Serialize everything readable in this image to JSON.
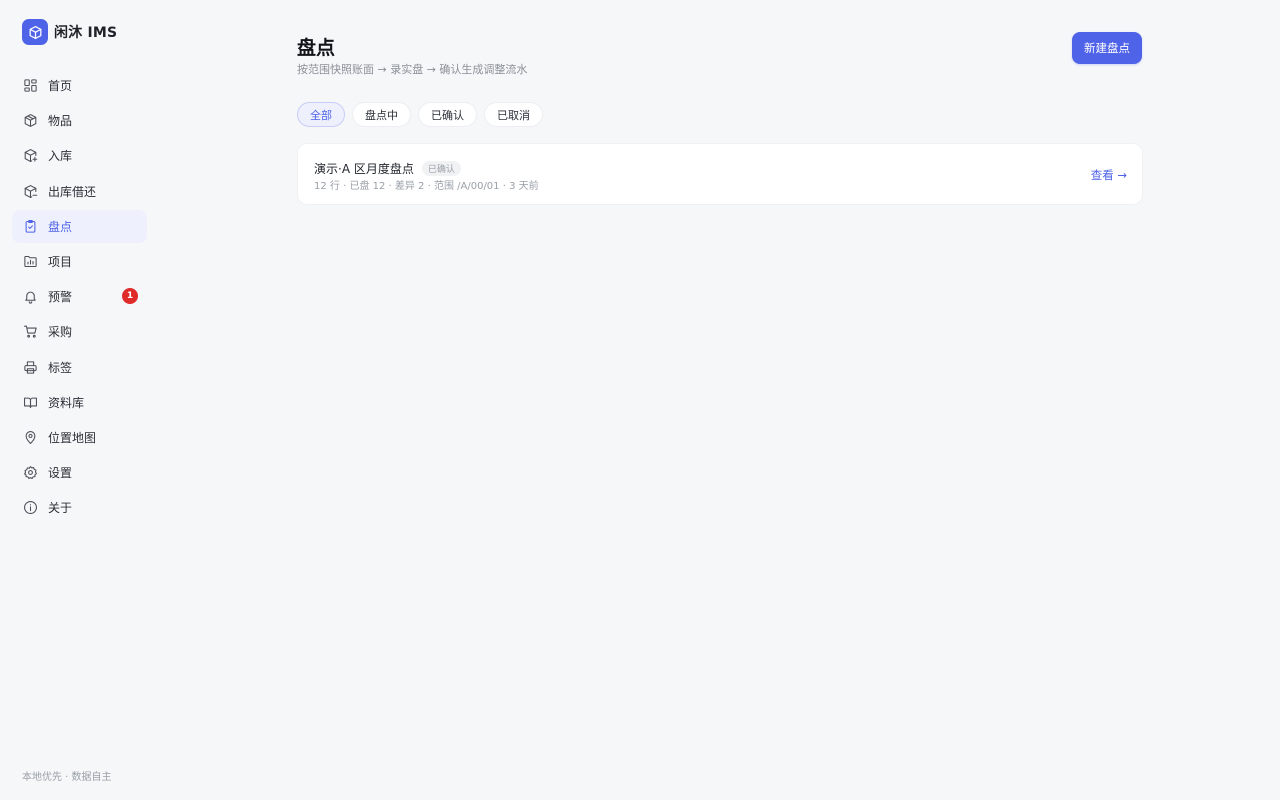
{
  "app": {
    "name": "闲沐 IMS",
    "brand_color": "#4f63e8",
    "logo_icon": "cube-icon"
  },
  "sidebar": {
    "items": [
      {
        "label": "首页",
        "icon": "dashboard-icon",
        "active": false
      },
      {
        "label": "物品",
        "icon": "box-icon",
        "active": false
      },
      {
        "label": "入库",
        "icon": "box-in-icon",
        "active": false
      },
      {
        "label": "出库借还",
        "icon": "box-out-icon",
        "active": false
      },
      {
        "label": "盘点",
        "icon": "clipboard-check-icon",
        "active": true
      },
      {
        "label": "项目",
        "icon": "project-chart-icon",
        "active": false
      },
      {
        "label": "预警",
        "icon": "bell-icon",
        "active": false,
        "badge": "1"
      },
      {
        "label": "采购",
        "icon": "cart-icon",
        "active": false
      },
      {
        "label": "标签",
        "icon": "printer-icon",
        "active": false
      },
      {
        "label": "资料库",
        "icon": "book-icon",
        "active": false
      },
      {
        "label": "位置地图",
        "icon": "map-pin-icon",
        "active": false
      },
      {
        "label": "设置",
        "icon": "gear-icon",
        "active": false
      },
      {
        "label": "关于",
        "icon": "info-icon",
        "active": false
      }
    ],
    "footer": "本地优先 · 数据自主"
  },
  "main": {
    "title": "盘点",
    "subtitle": "按范围快照账面 → 录实盘 → 确认生成调整流水",
    "new_button": "新建盘点",
    "filters": [
      {
        "label": "全部",
        "active": true
      },
      {
        "label": "盘点中",
        "active": false
      },
      {
        "label": "已确认",
        "active": false
      },
      {
        "label": "已取消",
        "active": false
      }
    ],
    "records": [
      {
        "title": "演示·A 区月度盘点",
        "status": "已确认",
        "meta": "12 行 · 已盘 12 · 差异 2 · 范围 /A/00/01 · 3 天前",
        "link": "查看 →"
      }
    ]
  }
}
